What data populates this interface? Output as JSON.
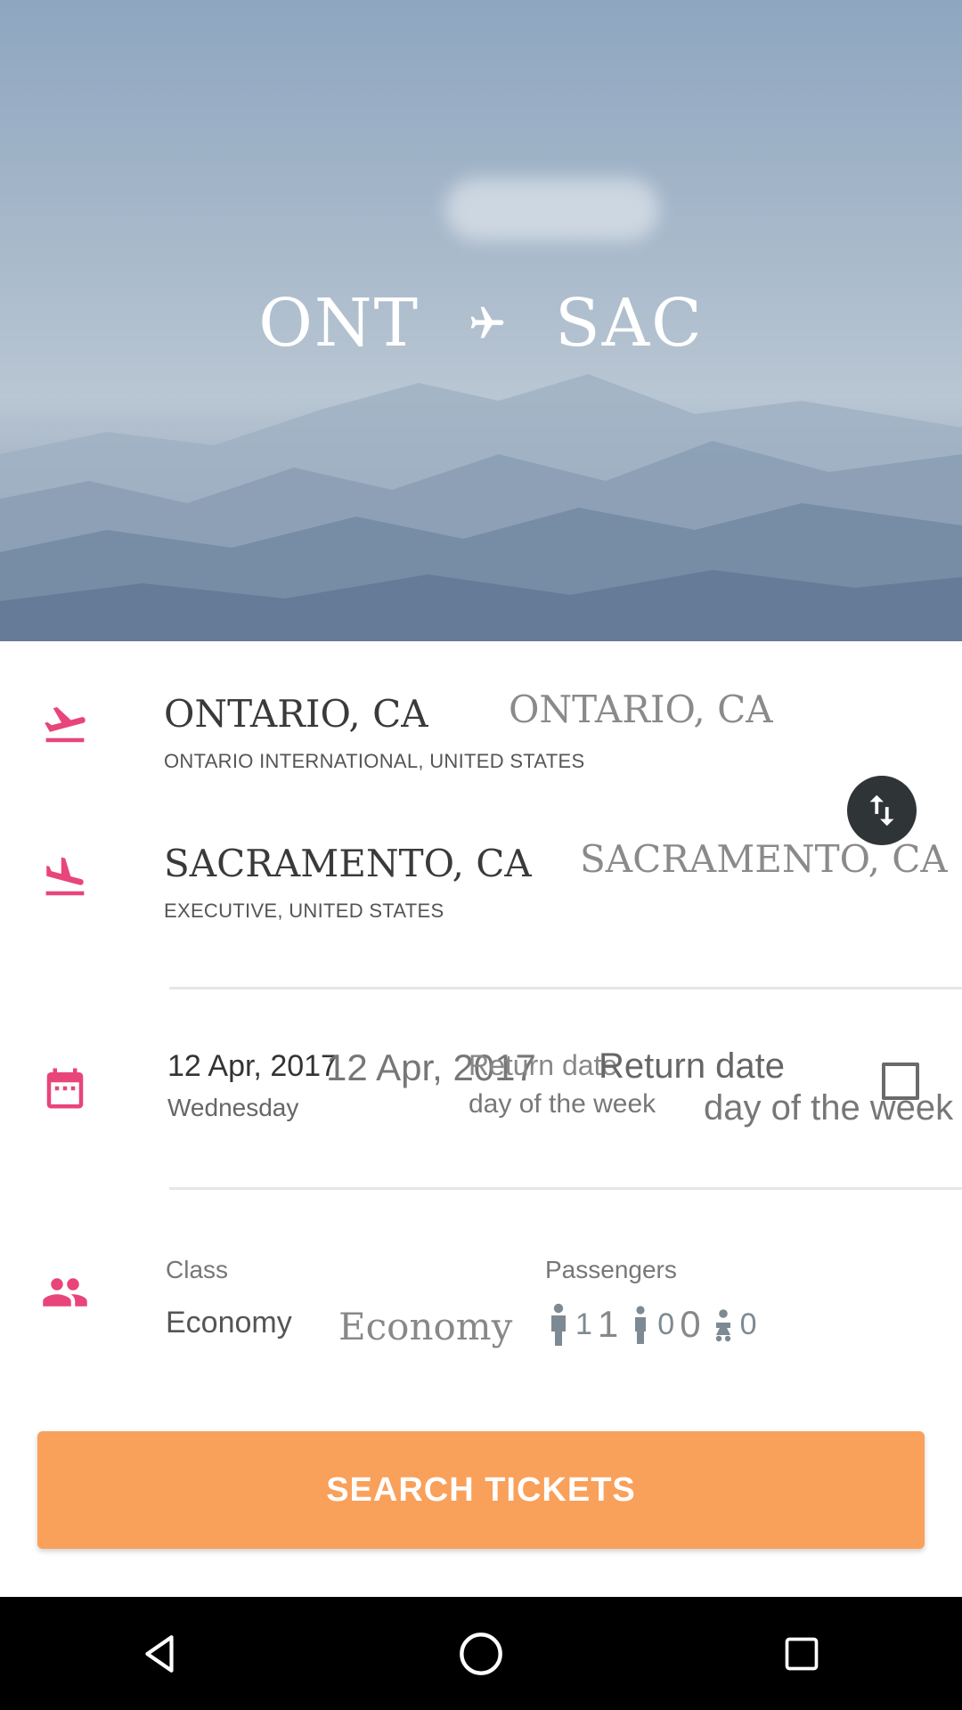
{
  "hero": {
    "origin_code": "ONT",
    "destination_code": "SAC"
  },
  "origin": {
    "city": "ONTARIO, CA",
    "airport": "ONTARIO INTERNATIONAL, UNITED STATES",
    "city_overlay": "ONTARIO, CA"
  },
  "destination": {
    "city": "SACRAMENTO, CA",
    "airport": "EXECUTIVE, UNITED STATES",
    "city_overlay": "SACRAMENTO, CA"
  },
  "dates": {
    "depart_date": "12 Apr, 2017",
    "depart_day": "Wednesday",
    "depart_date_overlay": "12 Apr, 2017",
    "return_label": "Return date",
    "return_sub": "day of the week",
    "return_label_overlay": "Return date",
    "return_sub_overlay": "day of the week"
  },
  "trip": {
    "class_label": "Class",
    "class_value": "Economy",
    "class_value_overlay": "Economy",
    "passengers_label": "Passengers",
    "adults": "1",
    "adults_overlay": "1",
    "children": "0",
    "children_overlay": "0",
    "infants": "0"
  },
  "search_button": "SEARCH TICKETS",
  "colors": {
    "accent_pink": "#e8457a",
    "button_orange": "#f9a05a",
    "swap_dark": "#2f3437"
  },
  "icons": {
    "route": "airplane-icon",
    "origin": "flight-takeoff-icon",
    "destination": "flight-land-icon",
    "date": "calendar-icon",
    "passengers": "people-icon",
    "swap": "swap-vertical-icon"
  }
}
